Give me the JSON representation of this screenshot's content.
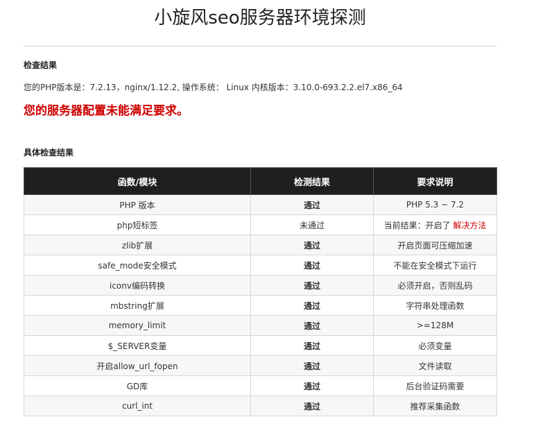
{
  "page": {
    "title": "小旋风seo服务器环境探测"
  },
  "summary": {
    "heading": "检查结果",
    "env_info": "您的PHP版本是：7.2.13，nginx/1.12.2, 操作系统： Linux 内核版本：3.10.0-693.2.2.el7.x86_64",
    "warning": "您的服务器配置未能满足要求。"
  },
  "details": {
    "heading": "具体检查结果",
    "columns": [
      "函数/模块",
      "检测结果",
      "要求说明"
    ],
    "rows": [
      {
        "name": "PHP 版本",
        "result": "通过",
        "status": "pass",
        "note": "PHP 5.3 ~ 7.2"
      },
      {
        "name": "php短标签",
        "result": "未通过",
        "status": "fail",
        "note": "当前结果：开启了",
        "link": "解决方法"
      },
      {
        "name": "zlib扩展",
        "result": "通过",
        "status": "pass",
        "note": "开启页面可压缩加速"
      },
      {
        "name": "safe_mode安全模式",
        "result": "通过",
        "status": "pass",
        "note": "不能在安全模式下运行"
      },
      {
        "name": "iconv编码转换",
        "result": "通过",
        "status": "pass",
        "note": "必须开启，否则乱码"
      },
      {
        "name": "mbstring扩展",
        "result": "通过",
        "status": "pass",
        "note": "字符串处理函数"
      },
      {
        "name": "memory_limit",
        "result": "通过",
        "status": "pass",
        "note": ">=128M"
      },
      {
        "name": "$_SERVER变量",
        "result": "通过",
        "status": "pass",
        "note": "必须变量"
      },
      {
        "name": "开启allow_url_fopen",
        "result": "通过",
        "status": "pass",
        "note": "文件读取"
      },
      {
        "name": "GD库",
        "result": "通过",
        "status": "pass",
        "note": "后台验证码需要"
      },
      {
        "name": "curl_int",
        "result": "通过",
        "status": "pass",
        "note": "推荐采集函数"
      }
    ]
  },
  "colors": {
    "header_bg": "#1f1f1f",
    "pass": "#1a8a1a",
    "fail": "#d00000"
  }
}
